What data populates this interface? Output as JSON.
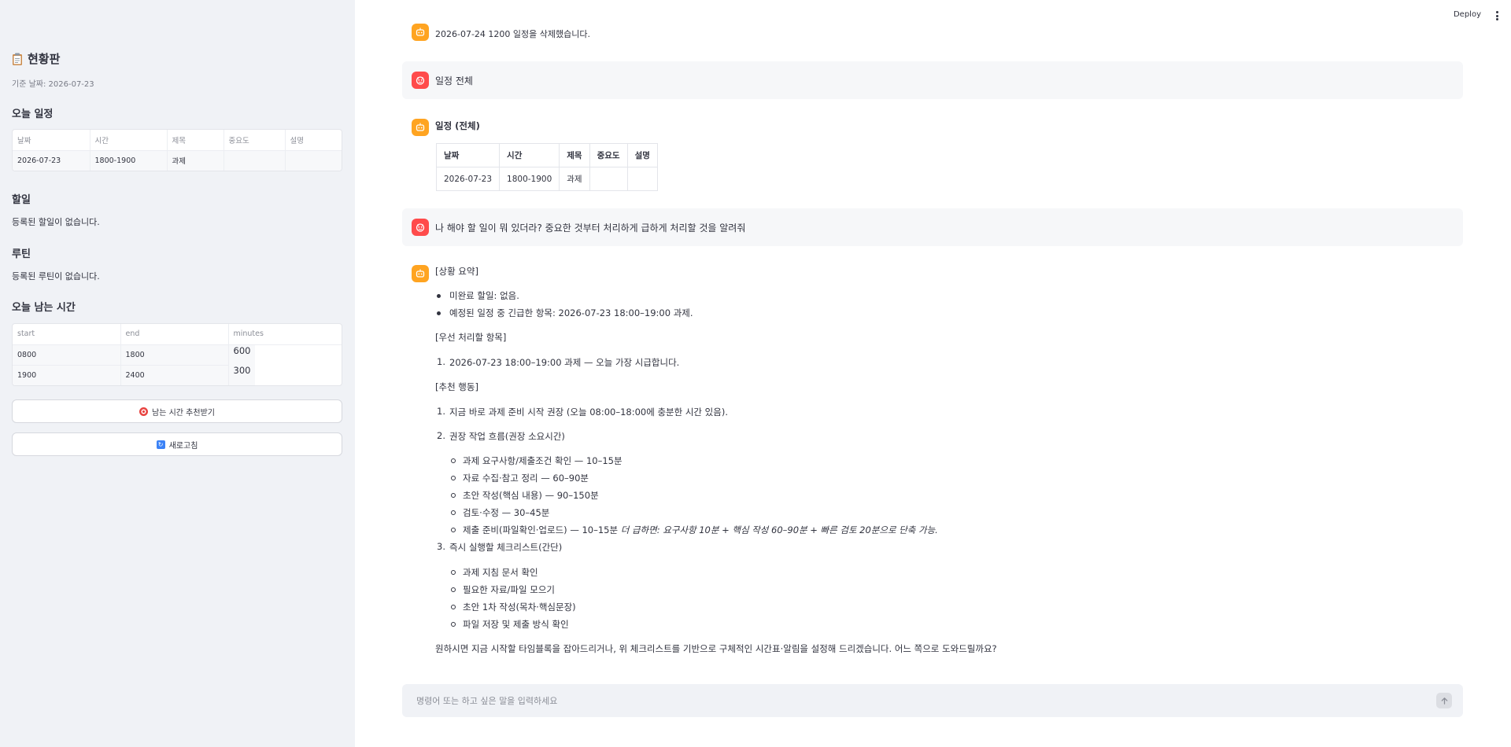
{
  "sidebar": {
    "title": "현황판",
    "base_date": "기준 날짜: 2026-07-23",
    "today_schedule": {
      "heading": "오늘 일정",
      "columns": [
        "날짜",
        "시간",
        "제목",
        "중요도",
        "설명"
      ],
      "rows": [
        [
          "2026-07-23",
          "1800-1900",
          "과제",
          "",
          ""
        ]
      ]
    },
    "todo": {
      "heading": "할일",
      "empty": "등록된 할일이 없습니다."
    },
    "routine": {
      "heading": "루틴",
      "empty": "등록된 루틴이 없습니다."
    },
    "free_time": {
      "heading": "오늘 남는 시간",
      "columns": [
        "start",
        "end",
        "minutes"
      ],
      "rows": [
        [
          "0800",
          "1800",
          "600"
        ],
        [
          "1900",
          "2400",
          "300"
        ]
      ]
    },
    "buttons": {
      "recommend": "남는 시간 추천받기",
      "refresh": "새로고침"
    }
  },
  "header": {
    "deploy": "Deploy"
  },
  "chat": {
    "cut_line": "2026-07-24 1200 일정을 삭제했습니다.",
    "user_msg_1": "일정 전체",
    "bot_1": {
      "title": "일정 (전체)",
      "columns": [
        "날짜",
        "시간",
        "제목",
        "중요도",
        "설명"
      ],
      "rows": [
        [
          "2026-07-23",
          "1800-1900",
          "과제",
          "",
          ""
        ]
      ]
    },
    "user_msg_2": "나 해야 할 일이 뭐 있더라? 중요한 것부터 처리하게 급하게 처리할 것을 알려줘",
    "bot_2": {
      "summary_label": "[상황 요약]",
      "summary_items": [
        "미완료 할일: 없음.",
        "예정된 일정 중 긴급한 항목: 2026-07-23 18:00–19:00 과제."
      ],
      "priority_label": "[우선 처리할 항목]",
      "priority_items": [
        "2026-07-23 18:00–19:00 과제 — 오늘 가장 시급합니다."
      ],
      "action_label": "[추천 행동]",
      "action_1": "지금 바로 과제 준비 시작 권장 (오늘 08:00–18:00에 충분한 시간 있음).",
      "action_2": "권장 작업 흐름(권장 소요시간)",
      "flow_items": [
        "과제 요구사항/제출조건 확인 — 10–15분",
        "자료 수집·참고 정리 — 60–90분",
        "초안 작성(핵심 내용) — 90–150분",
        "검토·수정 — 30–45분",
        "제출 준비(파일확인·업로드) — 10–15분"
      ],
      "flow_note": "더 급하면: 요구사항 10분 + 핵심 작성 60–90분 + 빠른 검토 20분으로 단축 가능.",
      "action_3": "즉시 실행할 체크리스트(간단)",
      "checklist": [
        "과제 지침 문서 확인",
        "필요한 자료/파일 모으기",
        "초안 1차 작성(목차·핵심문장)",
        "파일 저장 및 제출 방식 확인"
      ],
      "closing": "원하시면 지금 시작할 타임블록을 잡아드리거나, 위 체크리스트를 기반으로 구체적인 시간표·알림을 설정해 드리겠습니다. 어느 쪽으로 도와드릴까요?"
    }
  },
  "input": {
    "placeholder": "명령어 또는 하고 싶은 말을 입력하세요"
  }
}
